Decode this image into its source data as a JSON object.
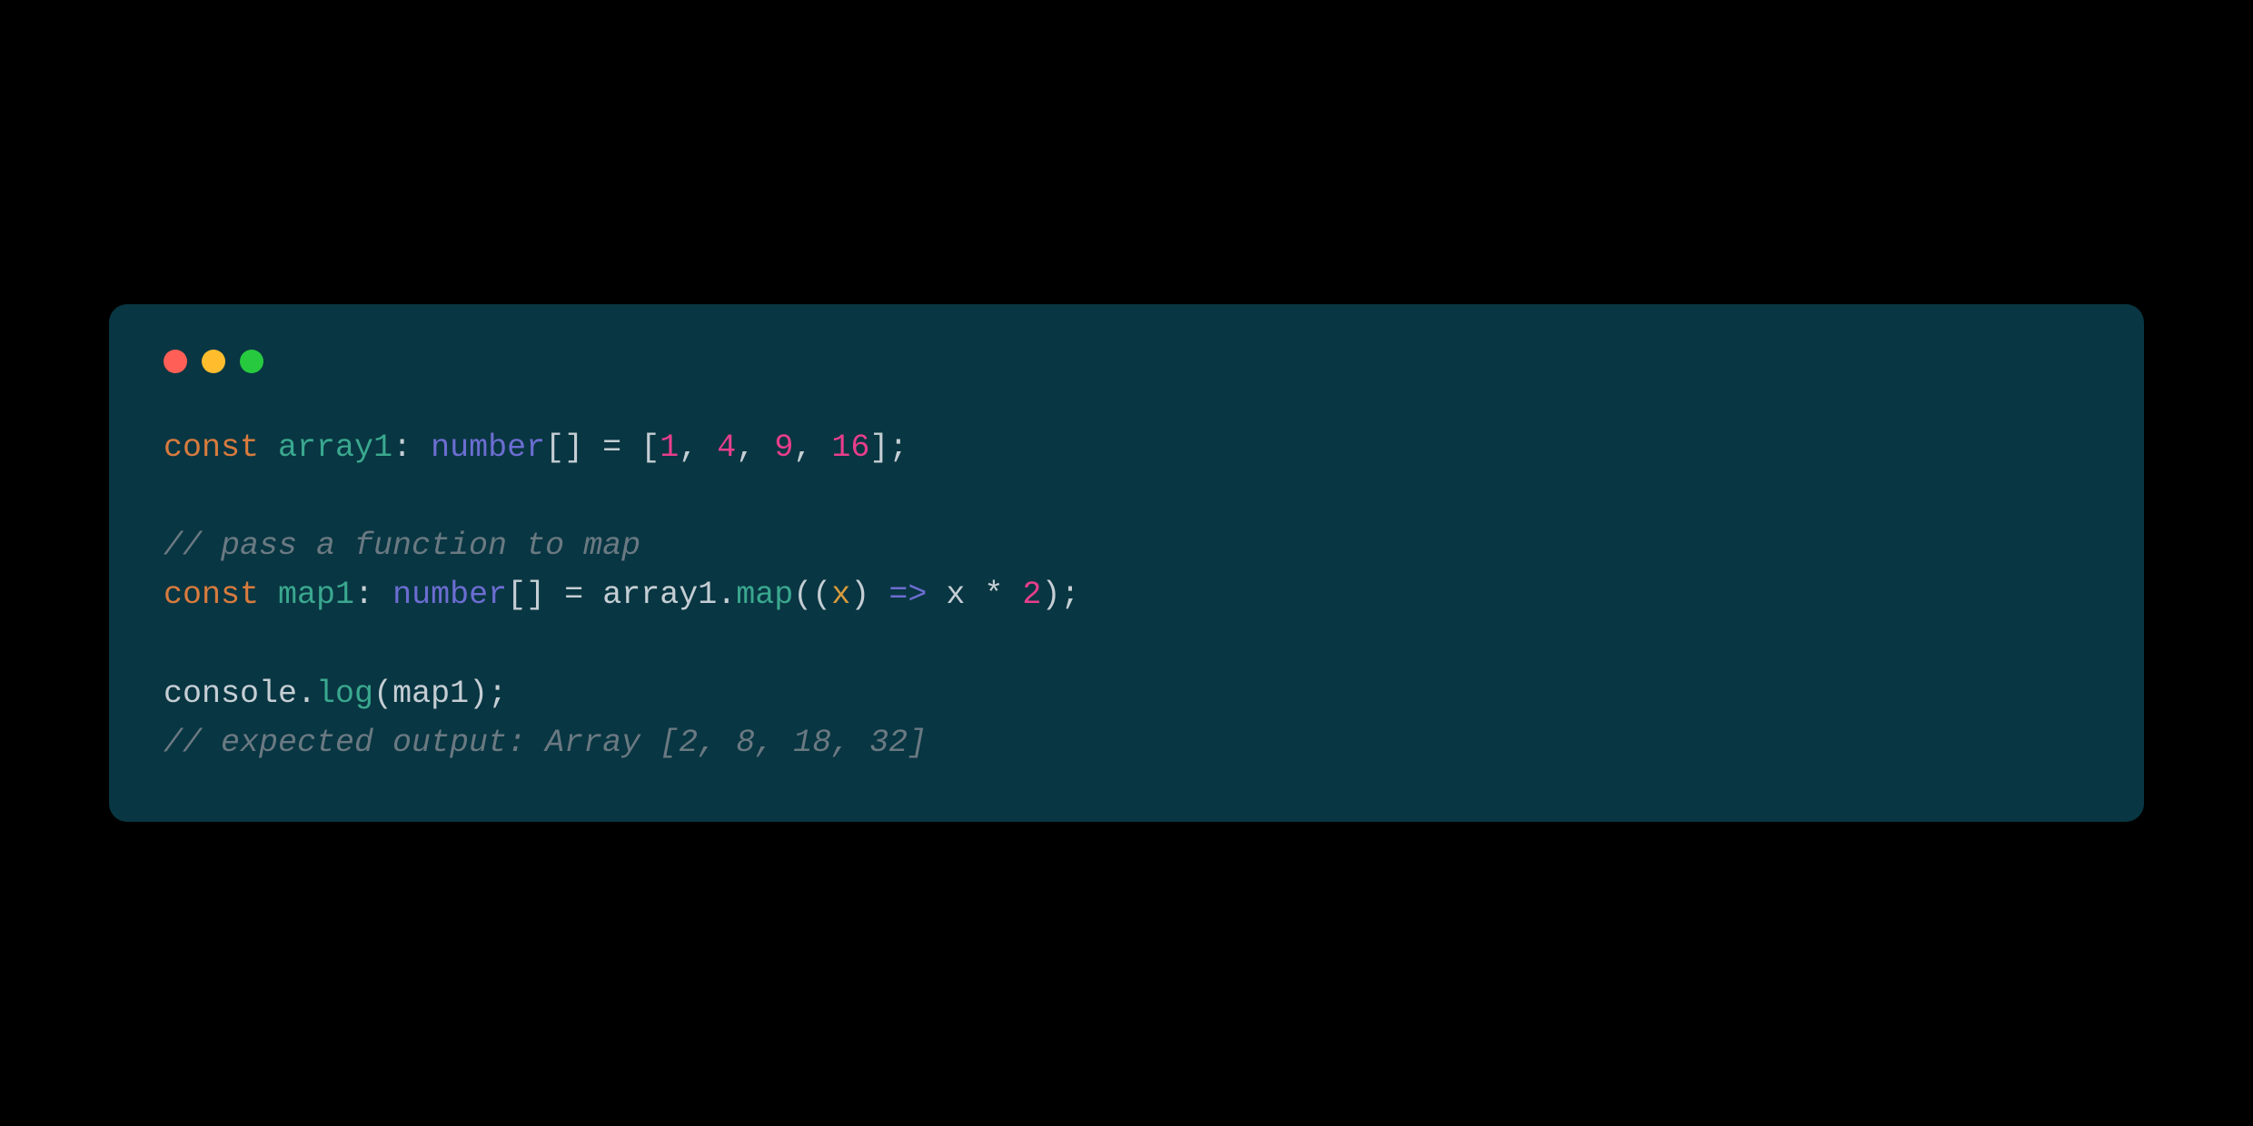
{
  "colors": {
    "windowBg": "#083642",
    "pageBg": "#000000",
    "trafficRed": "#ff5f56",
    "trafficYellow": "#ffbd2e",
    "trafficGreen": "#27c93f",
    "keyword": "#d87b3e",
    "identifier": "#3aa88f",
    "type": "#6c6dd1",
    "punct": "#c5ced4",
    "number": "#e83e8c",
    "comment": "#6a7982",
    "param": "#d89b3e"
  },
  "code": {
    "line1": {
      "const": "const",
      "sp1": " ",
      "ident": "array1",
      "colon": ":",
      "sp2": " ",
      "type": "number",
      "brackets": "[]",
      "sp3": " ",
      "eq": "=",
      "sp4": " ",
      "lbrack": "[",
      "n1": "1",
      "c1": ",",
      "sp5": " ",
      "n2": "4",
      "c2": ",",
      "sp6": " ",
      "n3": "9",
      "c3": ",",
      "sp7": " ",
      "n4": "16",
      "rbrack": "]",
      "semi": ";"
    },
    "line2": "",
    "line3": {
      "comment": "// pass a function to map"
    },
    "line4": {
      "const": "const",
      "sp1": " ",
      "ident": "map1",
      "colon": ":",
      "sp2": " ",
      "type": "number",
      "brackets": "[]",
      "sp3": " ",
      "eq": "=",
      "sp4": " ",
      "arr": "array1",
      "dot": ".",
      "method": "map",
      "lparen": "(",
      "lparen2": "(",
      "param": "x",
      "rparen2": ")",
      "sp5": " ",
      "arrow": "=>",
      "sp6": " ",
      "x2": "x",
      "sp7": " ",
      "star": "*",
      "sp8": " ",
      "two": "2",
      "rparen": ")",
      "semi": ";"
    },
    "line5": "",
    "line6": {
      "console": "console",
      "dot": ".",
      "log": "log",
      "lparen": "(",
      "arg": "map1",
      "rparen": ")",
      "semi": ";"
    },
    "line7": {
      "comment": "// expected output: Array [2, 8, 18, 32]"
    }
  }
}
